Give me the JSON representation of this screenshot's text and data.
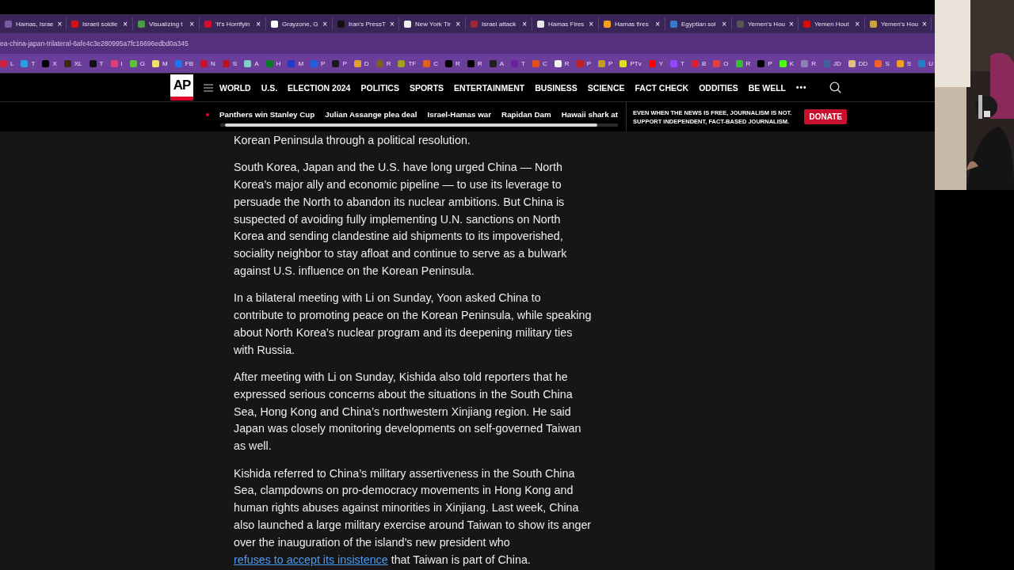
{
  "tabs": [
    {
      "title": "Hamas, Israe",
      "color": "#7a5aa0"
    },
    {
      "title": "Israeli soldie",
      "color": "#d0101a"
    },
    {
      "title": "Visualizing t",
      "color": "#4a9a4a"
    },
    {
      "title": "'It's Horrifyin",
      "color": "#d01030"
    },
    {
      "title": "Grayzone, G",
      "color": "#ffffff"
    },
    {
      "title": "Iran's PressT",
      "color": "#111111"
    },
    {
      "title": "New York Tir",
      "color": "#f0f0f0"
    },
    {
      "title": "Israel attack",
      "color": "#9a2a3a"
    },
    {
      "title": "Hamas Fires",
      "color": "#e8e8e8"
    },
    {
      "title": "Hamas fires",
      "color": "#f5a020"
    },
    {
      "title": "Egyptian sol",
      "color": "#3a78c8"
    },
    {
      "title": "Yemen's Hou",
      "color": "#555555"
    },
    {
      "title": "Yemen Hout",
      "color": "#d01010"
    },
    {
      "title": "Yemen's Hou",
      "color": "#c8a040"
    }
  ],
  "tab_close": "×",
  "address": "ea-china-japan-trilateral-6afe4c3e280995a7fc16696edbd0a345",
  "bookmarks": [
    {
      "label": "L",
      "color": "#d02040"
    },
    {
      "label": "T",
      "color": "#2aa0e0"
    },
    {
      "label": "X",
      "color": "#000000"
    },
    {
      "label": "XL",
      "color": "#3a2a10"
    },
    {
      "label": "T",
      "color": "#111111"
    },
    {
      "label": "I",
      "color": "#e0407a"
    },
    {
      "label": "G",
      "color": "#60c040"
    },
    {
      "label": "M",
      "color": "#f0e070"
    },
    {
      "label": "FB",
      "color": "#1877f2"
    },
    {
      "label": "N",
      "color": "#d01020"
    },
    {
      "label": "S",
      "color": "#c01020"
    },
    {
      "label": "A",
      "color": "#80d0c8"
    },
    {
      "label": "H",
      "color": "#0a7a2a"
    },
    {
      "label": "M",
      "color": "#1a3ad0"
    },
    {
      "label": "P",
      "color": "#2060e0"
    },
    {
      "label": "P",
      "color": "#1a1a1a"
    },
    {
      "label": "D",
      "color": "#e0a030"
    },
    {
      "label": "R",
      "color": "#806020"
    },
    {
      "label": "TF",
      "color": "#a0a020"
    },
    {
      "label": "C",
      "color": "#e06020"
    },
    {
      "label": "R",
      "color": "#000000"
    },
    {
      "label": "R",
      "color": "#000000"
    },
    {
      "label": "A",
      "color": "#202020"
    },
    {
      "label": "T",
      "color": "#6a20a0"
    },
    {
      "label": "C",
      "color": "#e05020"
    },
    {
      "label": "R",
      "color": "#f0f0f0"
    },
    {
      "label": "P",
      "color": "#c02020"
    },
    {
      "label": "P",
      "color": "#c0a020"
    },
    {
      "label": "PTv",
      "color": "#e0e020"
    },
    {
      "label": "Y",
      "color": "#ff0000"
    },
    {
      "label": "T",
      "color": "#9146ff"
    },
    {
      "label": "B",
      "color": "#e02030"
    },
    {
      "label": "O",
      "color": "#e04040"
    },
    {
      "label": "R",
      "color": "#30c030"
    },
    {
      "label": "P",
      "color": "#000000"
    },
    {
      "label": "K",
      "color": "#53fc18"
    },
    {
      "label": "R",
      "color": "#9080b0"
    },
    {
      "label": "JD",
      "color": "#4060a0"
    },
    {
      "label": "DD",
      "color": "#e0c080"
    },
    {
      "label": "S",
      "color": "#f06030"
    },
    {
      "label": "S",
      "color": "#f0a020"
    },
    {
      "label": "U",
      "color": "#2080c0"
    }
  ],
  "nav": {
    "logo": "AP",
    "items": [
      "WORLD",
      "U.S.",
      "ELECTION 2024",
      "POLITICS",
      "SPORTS",
      "ENTERTAINMENT",
      "BUSINESS",
      "SCIENCE",
      "FACT CHECK",
      "ODDITIES",
      "BE WELL"
    ],
    "more": "•••"
  },
  "trending": {
    "items": [
      "Panthers win Stanley Cup",
      "Julian Assange plea deal",
      "Israel-Hamas war",
      "Rapidan Dam",
      "Hawaii shark at"
    ],
    "promo": [
      "EVEN WHEN THE NEWS IS FREE, JOURNALISM IS NOT.",
      "SUPPORT INDEPENDENT, FACT-BASED JOURNALISM."
    ],
    "donate": "DONATE"
  },
  "article": {
    "paragraphs": [
      {
        "text": "Korean Peninsula through a political resolution."
      },
      {
        "text": "South Korea, Japan and the U.S. have long urged China — North Korea’s major ally and economic pipeline — to use its leverage to persuade the North to abandon its nuclear ambitions. But China is suspected of avoiding fully implementing U.N. sanctions on North Korea and sending clandestine aid shipments to its impoverished, sociality neighbor to stay afloat and continue to serve as a bulwark against U.S. influence on the Korean Peninsula."
      },
      {
        "text": "In a bilateral meeting with Li on Sunday, Yoon asked China to contribute to promoting peace on the Korean Peninsula, while speaking about North Korea’s nuclear program and its deepening military ties with Russia."
      },
      {
        "text": "After meeting with Li on Sunday, Kishida also told reporters that he expressed serious concerns about the situations in the South China Sea, Hong Kong and China’s northwestern Xinjiang region. He said Japan was closely monitoring developments on self-governed Taiwan as well."
      },
      {
        "text": "Kishida referred to China’s military assertiveness in the South China Sea, clampdowns on pro-democracy movements in Hong Kong and human rights abuses against minorities in Xinjiang. Last week, China also launched a large military exercise around Taiwan to show its anger over the inauguration of the island’s new president who ",
        "link": "refuses to accept its insistence",
        "after": " that Taiwan is part of China."
      }
    ]
  }
}
